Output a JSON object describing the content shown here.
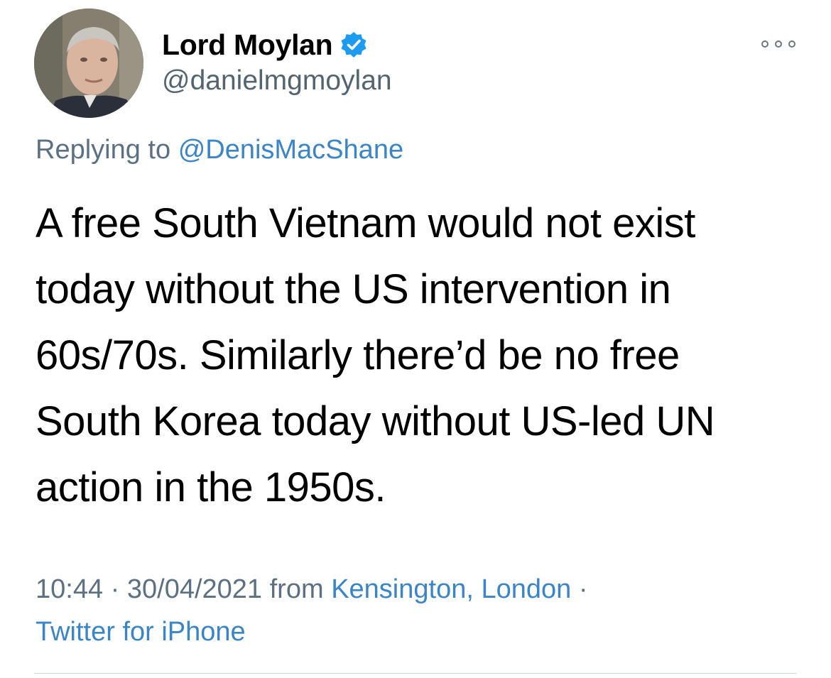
{
  "tweet": {
    "author": {
      "display_name": "Lord Moylan",
      "handle": "@danielmgmoylan",
      "verified": true,
      "avatar": "profile-photo-icon"
    },
    "more_icon": "more-horizontal-icon",
    "replying_prefix": "Replying to",
    "replying_to": "@DenisMacShane",
    "text_lines": [
      "A free South Vietnam would not exist",
      "today without the US intervention in",
      "60s/70s. Similarly there’d be no free",
      "South Korea today without US-led UN",
      "action in the 1950s."
    ],
    "time": "10:44",
    "separator": "·",
    "date": "30/04/2021",
    "from_label": "from",
    "location": "Kensington, London",
    "source": "Twitter for iPhone"
  },
  "colors": {
    "link": "#3a85c7",
    "secondary_text": "#5b7083",
    "verified_badge": "#1d9bf0",
    "divider": "#cfd9de"
  }
}
